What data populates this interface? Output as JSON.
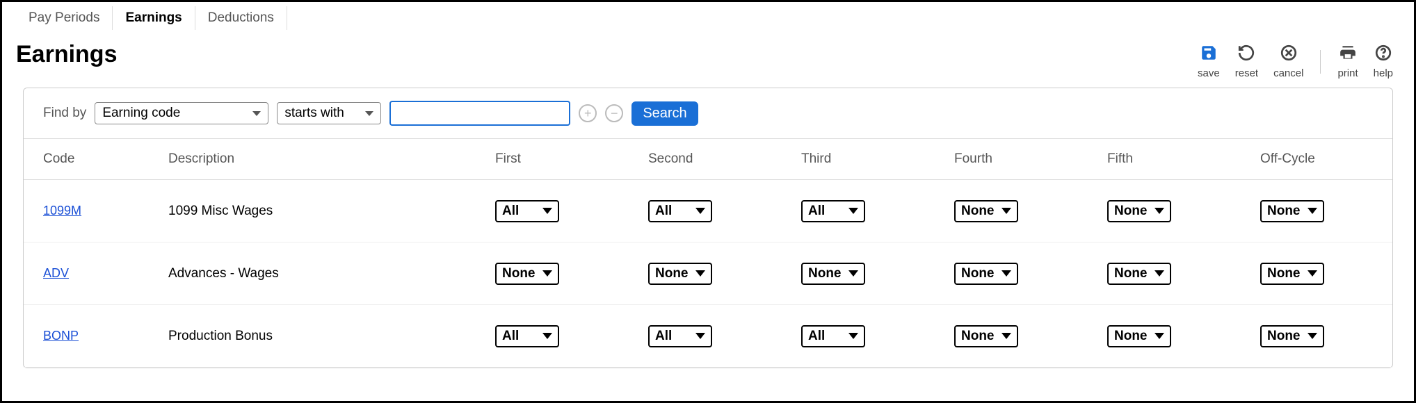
{
  "tabs": {
    "items": [
      "Pay Periods",
      "Earnings",
      "Deductions"
    ],
    "activeIndex": 1
  },
  "pageTitle": "Earnings",
  "toolbar": {
    "save": "save",
    "reset": "reset",
    "cancel": "cancel",
    "print": "print",
    "help": "help"
  },
  "findbar": {
    "label": "Find by",
    "fieldSelect": "Earning code",
    "opSelect": "starts with",
    "inputValue": "",
    "searchLabel": "Search"
  },
  "columns": [
    "Code",
    "Description",
    "First",
    "Second",
    "Third",
    "Fourth",
    "Fifth",
    "Off-Cycle"
  ],
  "rows": [
    {
      "code": "1099M",
      "desc": "1099 Misc Wages",
      "vals": [
        "All",
        "All",
        "All",
        "None",
        "None",
        "None"
      ]
    },
    {
      "code": "ADV",
      "desc": "Advances - Wages",
      "vals": [
        "None",
        "None",
        "None",
        "None",
        "None",
        "None"
      ]
    },
    {
      "code": "BONP",
      "desc": "Production Bonus",
      "vals": [
        "All",
        "All",
        "All",
        "None",
        "None",
        "None"
      ]
    }
  ]
}
